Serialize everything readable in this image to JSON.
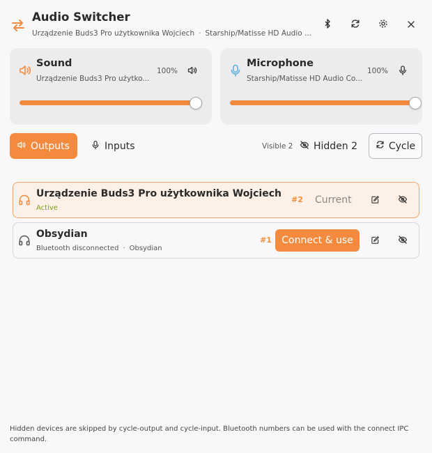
{
  "header": {
    "title": "Audio Switcher",
    "subtitle_output": "Urządzenie Buds3 Pro użytkownika Wojciech",
    "subtitle_sep": "·",
    "subtitle_input": "Starship/Matisse HD Audio ...",
    "icons": [
      "swap-arrows-icon",
      "bluetooth-icon",
      "refresh-icon",
      "settings-icon",
      "close-icon"
    ]
  },
  "sound": {
    "title": "Sound",
    "device": "Urządzenie Buds3 Pro użytko...",
    "percent": "100%",
    "level": 1.0
  },
  "microphone": {
    "title": "Microphone",
    "device": "Starship/Matisse HD Audio Co...",
    "percent": "100%",
    "level": 1.0
  },
  "toolbar": {
    "outputs_label": "Outputs",
    "inputs_label": "Inputs",
    "visible_label": "Visible 2",
    "hidden_label": "Hidden 2",
    "cycle_label": "Cycle"
  },
  "devices": [
    {
      "name": "Urządzenie Buds3 Pro użytkownika Wojciech",
      "status": "Active",
      "number": "#2",
      "action": "Current"
    },
    {
      "name": "Obsydian",
      "status": "Bluetooth disconnected",
      "status_sep": "·",
      "status_extra": "Obsydian",
      "number": "#1",
      "action": "Connect & use"
    }
  ],
  "footer": "Hidden devices are skipped by cycle-output and cycle-input. Bluetooth numbers can be used with the connect IPC command.",
  "colors": {
    "accent": "#f48a3d",
    "accent_text": "#f0903c",
    "active_status": "#7aa217",
    "mic_icon": "#5aaee0",
    "card_bg": "#ececee"
  }
}
